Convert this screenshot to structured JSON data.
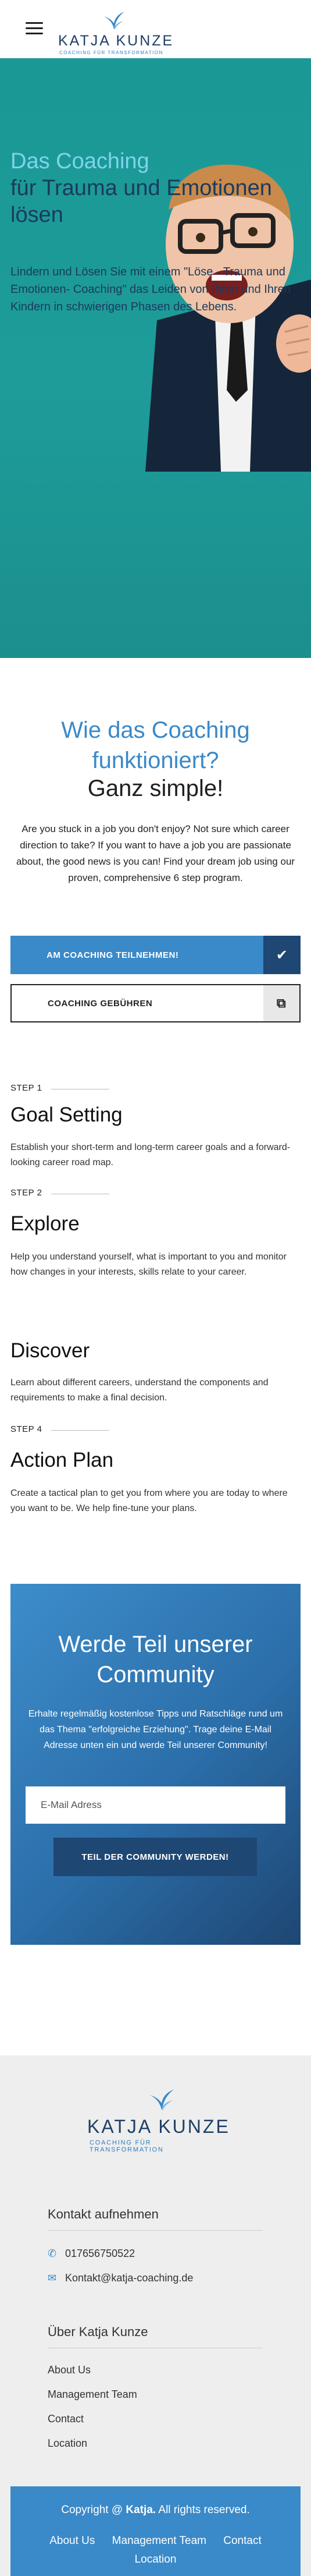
{
  "header": {
    "logo_name": "KATJA KUNZE",
    "logo_tag": "COACHING FÜR TRANSFORMATION",
    "menu_icon": "hamburger-icon"
  },
  "hero": {
    "title_line1": "Das Coaching",
    "title_line2": "für Trauma und Emotionen lösen",
    "text": "Lindern und Lösen Sie mit einem \"Löse - Trauma und Emotionen- Coaching\" das Leiden von Ihren und Ihren Kindern in schwierigen Phasen des Lebens."
  },
  "how": {
    "title": "Wie das Coaching funktioniert?",
    "subtitle": "Ganz simple!",
    "text": "Are you stuck in a job you don't enjoy? Not sure which career direction to take? If you want to have a job you are passionate about, the good news is you can! Find your dream job using our proven, comprehensive 6 step program.",
    "primary_cta": "AM COACHING TEILNEHMEN!",
    "secondary_cta": "COACHING GEBÜHREN"
  },
  "steps": [
    {
      "label": "STEP 1",
      "title": "Goal Setting",
      "text": "Establish your short-term and long-term career goals and a forward-looking career road map."
    },
    {
      "label": "STEP 2",
      "title": "Explore",
      "text": "Help you understand yourself, what is important to you and monitor how changes in your interests, skills relate to your career."
    },
    {
      "label": "",
      "title": "Discover",
      "text": "Learn about different careers, understand the components and requirements to make a final decision."
    },
    {
      "label": "STEP 4",
      "title": "Action Plan",
      "text": "Create a tactical plan to get you from where you are today to where you want to be. We help fine-tune your plans."
    }
  ],
  "community": {
    "title": "Werde Teil unserer Community",
    "text": "Erhalte regelmäßig kostenlose Tipps und Ratschläge rund um das Thema \"erfolgreiche Erziehung\". Trage deine E-Mail Adresse unten ein und werde Teil unserer Community!",
    "email_placeholder": "E-Mail Adress",
    "button": "TEIL DER COMMUNITY WERDEN!"
  },
  "footer": {
    "logo_name": "KATJA KUNZE",
    "logo_tag": "COACHING FÜR TRANSFORMATION",
    "contact_heading": "Kontakt aufnehmen",
    "phone": "017656750522",
    "email": "Kontakt@katja-coaching.de",
    "about_heading": "Über Katja Kunze",
    "links": [
      "About Us",
      "Management Team",
      "Contact",
      "Location"
    ],
    "copyright_prefix": "Copyright @",
    "copyright_brand": "Katja.",
    "copyright_suffix": "All rights reserved.",
    "bar_links": [
      "About Us",
      "Management Team",
      "Contact",
      "Location"
    ]
  },
  "colors": {
    "accent": "#3a89c9",
    "dark_blue": "#1e4773",
    "hero_teal": "#1a9896",
    "footer_bg": "#eeeeee"
  }
}
